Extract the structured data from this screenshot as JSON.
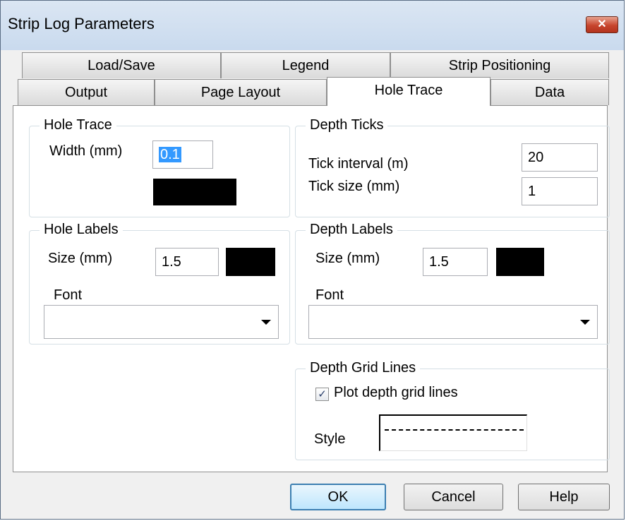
{
  "window": {
    "title": "Strip Log Parameters",
    "close_symbol": "✕"
  },
  "tabs": {
    "row1": [
      "Load/Save",
      "Legend",
      "Strip Positioning"
    ],
    "row2": [
      "Output",
      "Page Layout",
      "Hole Trace",
      "Data"
    ],
    "active": "Hole Trace"
  },
  "hole_trace": {
    "title": "Hole Trace",
    "width_label": "Width (mm)",
    "width_value": "0.1",
    "color": "#000000"
  },
  "depth_ticks": {
    "title": "Depth Ticks",
    "interval_label": "Tick interval (m)",
    "interval_value": "20",
    "size_label": "Tick size (mm)",
    "size_value": "1"
  },
  "hole_labels": {
    "title": "Hole Labels",
    "size_label": "Size (mm)",
    "size_value": "1.5",
    "font_label": "Font",
    "font_value": "",
    "color": "#000000"
  },
  "depth_labels": {
    "title": "Depth Labels",
    "size_label": "Size (mm)",
    "size_value": "1.5",
    "font_label": "Font",
    "font_value": "",
    "color": "#000000"
  },
  "depth_grid": {
    "title": "Depth Grid Lines",
    "checkbox_label": "Plot depth grid lines",
    "checked": true,
    "check_mark": "✓",
    "style_label": "Style"
  },
  "buttons": {
    "ok": "OK",
    "cancel": "Cancel",
    "help": "Help"
  }
}
